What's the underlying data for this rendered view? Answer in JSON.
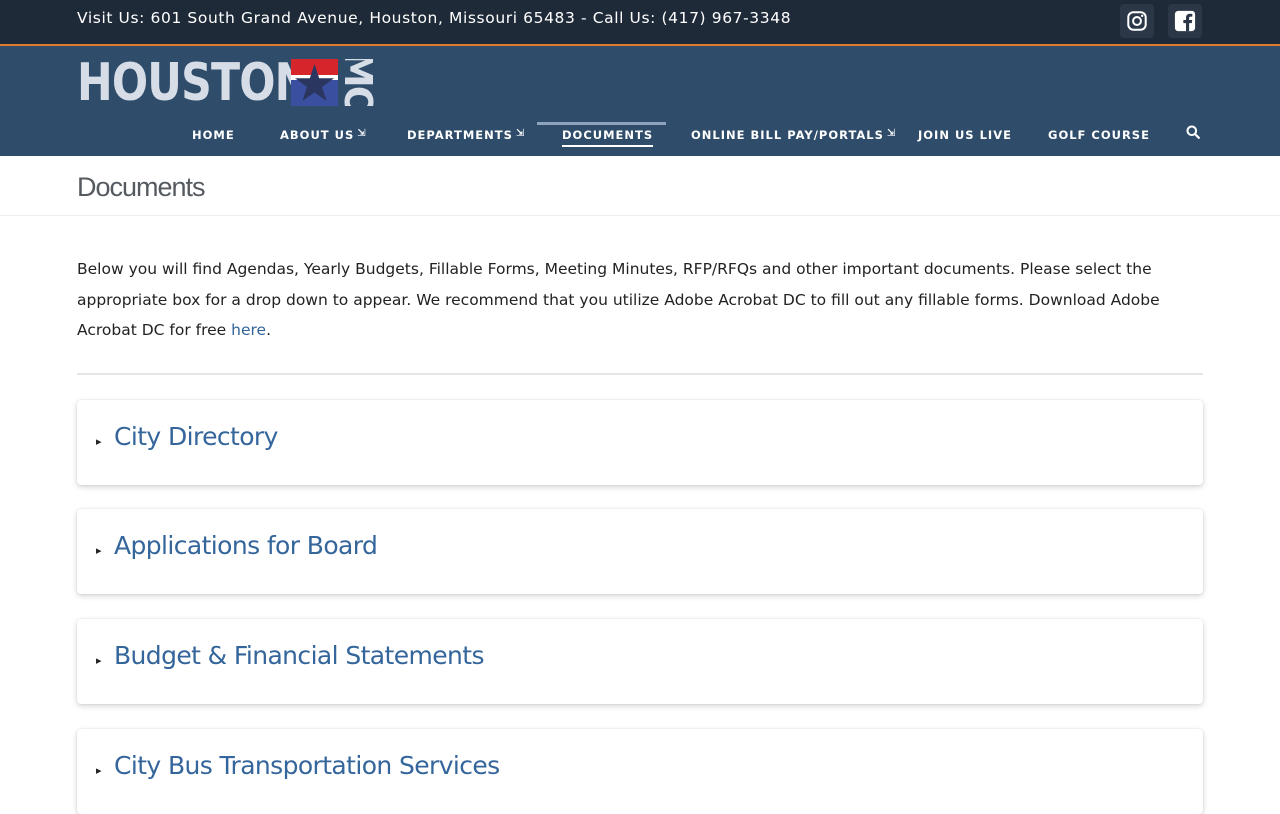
{
  "topbar": {
    "info": "Visit Us: 601 South Grand Avenue, Houston, Missouri 65483 - Call Us: (417) 967-3348",
    "social": [
      {
        "icon": "instagram-icon"
      },
      {
        "icon": "facebook-icon"
      }
    ]
  },
  "logo": {
    "text": "HOUSTON",
    "suffix": "MO"
  },
  "nav": {
    "items": [
      {
        "label": "HOME",
        "dropdown": false
      },
      {
        "label": "ABOUT US",
        "dropdown": true
      },
      {
        "label": "DEPARTMENTS",
        "dropdown": true
      },
      {
        "label": "DOCUMENTS",
        "dropdown": false,
        "active": true
      },
      {
        "label": "ONLINE BILL PAY/PORTALS",
        "dropdown": true
      },
      {
        "label": "JOIN US LIVE",
        "dropdown": false
      },
      {
        "label": "GOLF COURSE",
        "dropdown": false
      }
    ],
    "dropdown_arrow": "⇲",
    "search_icon": "search-icon"
  },
  "page": {
    "title": "Documents"
  },
  "intro": {
    "text": "Below you will find Agendas, Yearly Budgets, Fillable Forms, Meeting Minutes, RFP/RFQs and other important documents. Please select the appropriate box for a drop down to appear. We recommend that you utilize Adobe Acrobat DC to fill out any fillable forms.  Download Adobe Acrobat DC for free ",
    "link": "here",
    "trailing": "."
  },
  "accordion": {
    "marker": "▸",
    "items": [
      {
        "title": "City Directory"
      },
      {
        "title": "Applications for Board"
      },
      {
        "title": "Budget & Financial Statements"
      },
      {
        "title": "City Bus Transportation Services"
      }
    ]
  },
  "colors": {
    "topbar_bg": "#1f2a38",
    "topbar_accent": "#e07a2c",
    "masthead_bg": "#2f4d6b",
    "link": "#34659b"
  }
}
